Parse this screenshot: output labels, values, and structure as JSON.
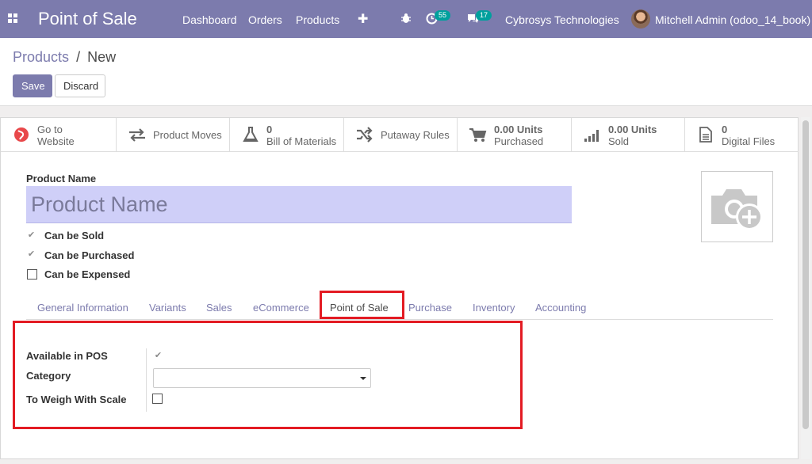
{
  "navbar": {
    "brand": "Point of Sale",
    "menu": [
      "Dashboard",
      "Orders",
      "Products"
    ],
    "plus": "✚",
    "activity_count": "55",
    "message_count": "17",
    "company": "Cybrosys Technologies",
    "user": "Mitchell Admin (odoo_14_book)"
  },
  "breadcrumb": {
    "parent": "Products",
    "separator": "/",
    "current": "New"
  },
  "toolbar": {
    "save_label": "Save",
    "discard_label": "Discard"
  },
  "smart_buttons": {
    "website": {
      "line1": "Go to",
      "line2": "Website"
    },
    "moves": {
      "label": "Product Moves"
    },
    "bom": {
      "value": "0",
      "label": "Bill of Materials"
    },
    "putaway": {
      "label": "Putaway Rules"
    },
    "purchased": {
      "value": "0.00 Units",
      "label": "Purchased"
    },
    "sold": {
      "value": "0.00 Units",
      "label": "Sold"
    },
    "files": {
      "value": "0",
      "label": "Digital Files"
    }
  },
  "form": {
    "name_label": "Product Name",
    "name_placeholder": "Product Name",
    "can_be_sold": "Can be Sold",
    "can_be_purchased": "Can be Purchased",
    "can_be_expensed": "Can be Expensed"
  },
  "tabs": [
    "General Information",
    "Variants",
    "Sales",
    "eCommerce",
    "Point of Sale",
    "Purchase",
    "Inventory",
    "Accounting"
  ],
  "pos_tab": {
    "available_in_pos": "Available in POS",
    "category": "Category",
    "category_value": "",
    "to_weigh": "To Weigh With Scale"
  },
  "colors": {
    "brand": "#7c7bad",
    "badge": "#00a09d",
    "highlight": "#e31b23",
    "name_field": "#cfcff8"
  }
}
